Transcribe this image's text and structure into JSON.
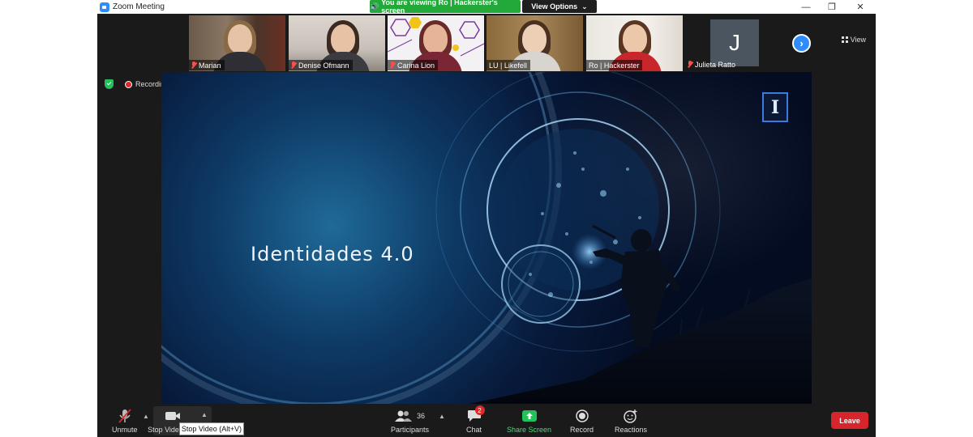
{
  "window": {
    "title": "Zoom Meeting"
  },
  "banner": {
    "text": "You are viewing Ro | Hackerster's screen",
    "view_options": "View Options"
  },
  "gallery": {
    "participants": [
      {
        "name": "Marian",
        "muted": true
      },
      {
        "name": "Denise Ofmann",
        "muted": true
      },
      {
        "name": "Carina Lion",
        "muted": true
      },
      {
        "name": "LU | Likefell",
        "muted": false
      },
      {
        "name": "Ro | Hackerster",
        "muted": false
      },
      {
        "name": "Julieta Ratto",
        "muted": true,
        "initial": "J"
      }
    ],
    "view_label": "View"
  },
  "status": {
    "recording": "Recording"
  },
  "shared_screen": {
    "title": "Identidades 4.0",
    "logo_letter": "I"
  },
  "toolbar": {
    "unmute": "Unmute",
    "stop_video": "Stop Video",
    "stop_video_tooltip": "Stop Video (Alt+V)",
    "participants": "Participants",
    "participants_count": "36",
    "chat": "Chat",
    "chat_badge": "2",
    "share_screen": "Share Screen",
    "record": "Record",
    "reactions": "Reactions",
    "leave": "Leave"
  },
  "colors": {
    "accent": "#2d8cff",
    "share_green": "#23a93a",
    "leave_red": "#d6262b",
    "speaker_outline": "#b9d82e"
  }
}
